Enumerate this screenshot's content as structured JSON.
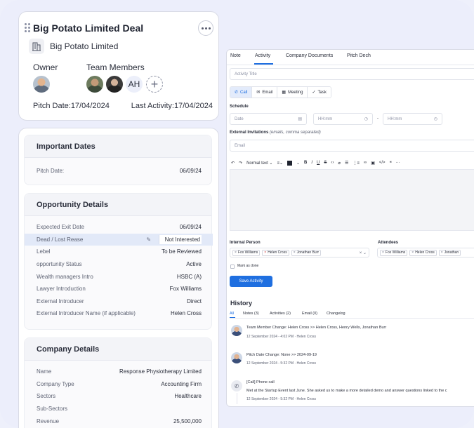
{
  "deal": {
    "title": "Big Potato Limited Deal",
    "company": "Big Potato Limited",
    "owner_label": "Owner",
    "team_label": "Team Members",
    "team_initials": "AH",
    "pitch_date_label": "Pitch Date:",
    "pitch_date": "17/04/2024",
    "last_activity_label": "Last Activity:",
    "last_activity": "17/04/2024"
  },
  "important_dates": {
    "title": "Important Dates",
    "rows": [
      {
        "k": "Pitch Date:",
        "v": "06/09/24"
      }
    ]
  },
  "opportunity": {
    "title": "Opportunity Details",
    "rows": [
      {
        "k": "Expected Exit Date",
        "v": "06/09/24"
      },
      {
        "k": "Dead / Lost Rease",
        "v": "Not Interested"
      },
      {
        "k": "Lebel",
        "v": "To be Reviewed"
      },
      {
        "k": "opportunity Status",
        "v": "Active"
      },
      {
        "k": "Wealth managers Intro",
        "v": "HSBC (A)"
      },
      {
        "k": "Lawyer Introduction",
        "v": "Fox Williams"
      },
      {
        "k": "External Introducer",
        "v": "Direct"
      },
      {
        "k": "External Introducer Name (if applicable)",
        "v": "Helen Cross"
      }
    ]
  },
  "company_details": {
    "title": "Company Details",
    "rows": [
      {
        "k": "Name",
        "v": "Response Physiotherapy Limited"
      },
      {
        "k": "Company Type",
        "v": "Accounting Firm"
      },
      {
        "k": "Sectors",
        "v": "Healthcare"
      },
      {
        "k": "Sub-Sectors",
        "v": ""
      },
      {
        "k": "Revenue",
        "v": "25,500,000"
      }
    ]
  },
  "activity": {
    "tabs": [
      "Note",
      "Activity",
      "Company Documents",
      "Pitch Dech"
    ],
    "title_placeholder": "Activity Title",
    "types": [
      "Call",
      "Email",
      "Meeting",
      "Task"
    ],
    "schedule_label": "Schedule",
    "date_placeholder": "Date",
    "time_placeholder_1": "HH:mm",
    "time_dash": "-",
    "time_placeholder_2": "HH:mm",
    "ext_label": "External Invitations",
    "ext_hint": "(emails, comma separated)",
    "email_placeholder": "Email",
    "toolbar_text": "Normal text",
    "internal_label": "Internal Person",
    "internal_chips": [
      "Fox Williams",
      "Helen Cross",
      "Jonathan Burr"
    ],
    "attendees_label": "Attendees",
    "attendee_chips": [
      "Fox Williams",
      "Helen Cross",
      "Jonathan"
    ],
    "mark_done": "Mark as done",
    "save_label": "Save Activity"
  },
  "history": {
    "title": "History",
    "tabs": [
      "All",
      "Notes (3)",
      "Activities (2)",
      "Email (0)",
      "Changelog"
    ],
    "items": [
      {
        "title": "Team Member Change: Helen Cross >> Helen Cross, Henry Wells, Jonathan Burr",
        "date": "12 September 2024 - 4:02 PM",
        "user": "Helen Cross"
      },
      {
        "title": "Pitch Date Change: None >> 2024-09-19",
        "date": "12 September 2024 - 5:32 PM",
        "user": "Helen Cross"
      },
      {
        "title": "[Call] Phone call",
        "body": "Met at the Startup Event last June. She asked us to make a more detailed demo and answer questions linked to the c",
        "date": "12 September 2024 - 5:32 PM",
        "user": "Helen Cross"
      }
    ]
  },
  "colors": {
    "accent": "#1f6fe0",
    "danger": "#d23a3a",
    "background": "#eceefb"
  }
}
